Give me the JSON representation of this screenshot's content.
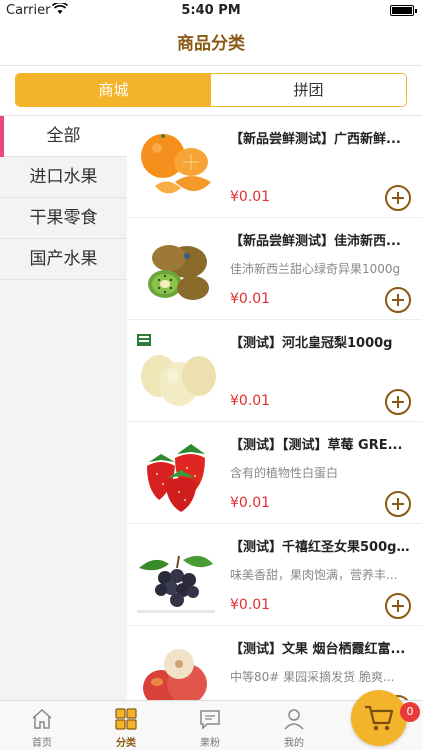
{
  "status_bar": {
    "carrier": "Carrier",
    "time": "5:40 PM"
  },
  "header": {
    "title": "商品分类"
  },
  "segment": {
    "tabs": [
      {
        "label": "商城",
        "active": true
      },
      {
        "label": "拼团",
        "active": false
      }
    ]
  },
  "sidebar": {
    "items": [
      {
        "label": "全部",
        "active": true
      },
      {
        "label": "进口水果",
        "active": false
      },
      {
        "label": "干果零食",
        "active": false
      },
      {
        "label": "国产水果",
        "active": false
      }
    ]
  },
  "products": [
    {
      "title": "【新品尝鲜测试】广西新鲜...",
      "desc": "",
      "price": "¥0.01",
      "image": "orange"
    },
    {
      "title": "【新品尝鲜测试】佳沛新西...",
      "desc": "佳沛新西兰甜心绿奇异果1000g",
      "price": "¥0.01",
      "image": "kiwi"
    },
    {
      "title": "【测试】河北皇冠梨1000g",
      "desc": "",
      "price": "¥0.01",
      "image": "pear"
    },
    {
      "title": "【测试】【测试】草莓 GRE...",
      "desc": "含有的植物性白蛋白",
      "price": "¥0.01",
      "image": "strawberry"
    },
    {
      "title": "【测试】千禧红圣女果500g...",
      "desc": "味美香甜，果肉饱满，营养丰...",
      "price": "¥0.01",
      "image": "grape"
    },
    {
      "title": "【测试】文果 烟台栖霞红富...",
      "desc": "中等80# 果园采摘发货 脆爽...",
      "price": "",
      "image": "apple"
    }
  ],
  "tab_bar": {
    "tabs": [
      {
        "label": "首页",
        "icon": "home-icon",
        "active": false
      },
      {
        "label": "分类",
        "icon": "category-icon",
        "active": true
      },
      {
        "label": "果粉",
        "icon": "chat-icon",
        "active": false
      },
      {
        "label": "我的",
        "icon": "user-icon",
        "active": false
      }
    ]
  },
  "cart": {
    "badge": "0",
    "icon": "cart-icon"
  },
  "colors": {
    "accent": "#f3b32a",
    "brown": "#8a5a14",
    "price": "#e0302c",
    "sidebar_indicator": "#e8487a"
  }
}
